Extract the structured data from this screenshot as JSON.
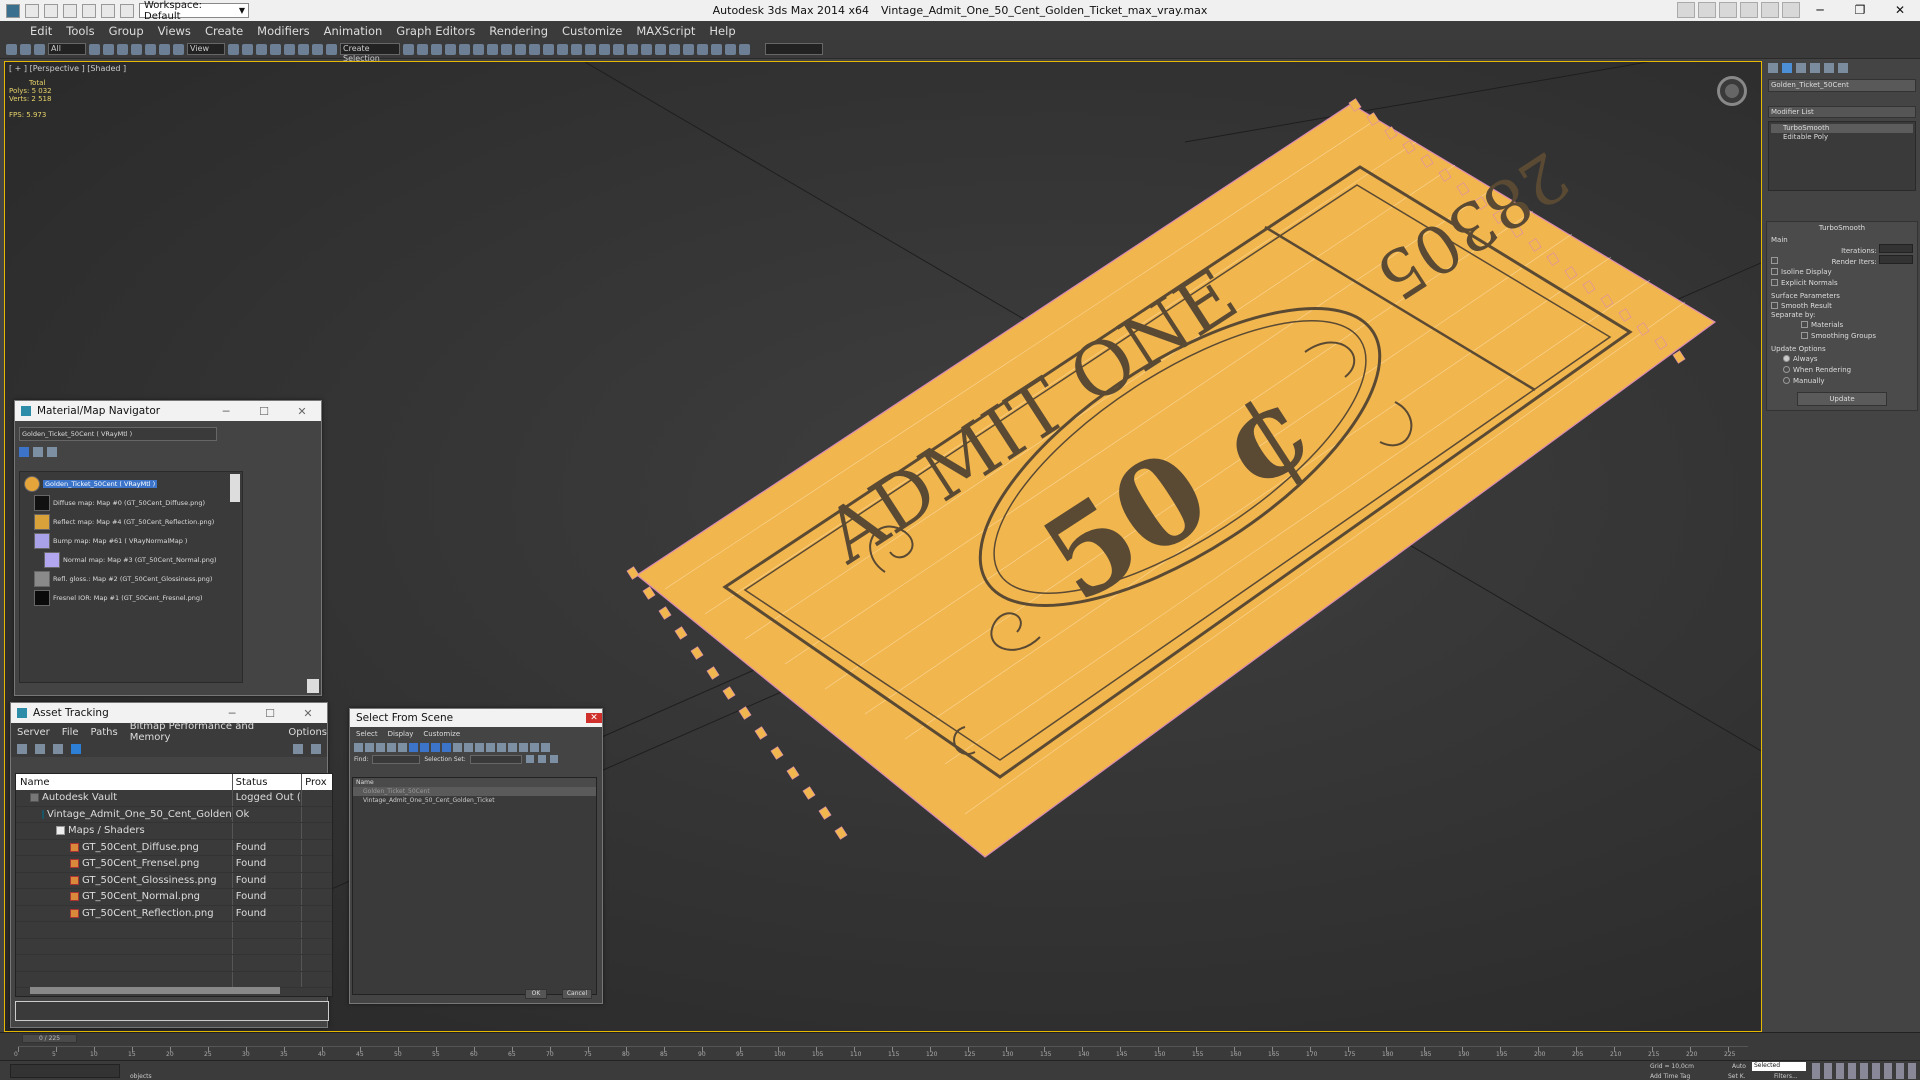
{
  "title_bar": {
    "app": "Autodesk 3ds Max  2014 x64",
    "file": "Vintage_Admit_One_50_Cent_Golden_Ticket_max_vray.max",
    "workspace": "Workspace: Default"
  },
  "menu": [
    "Edit",
    "Tools",
    "Group",
    "Views",
    "Create",
    "Modifiers",
    "Animation",
    "Graph Editors",
    "Rendering",
    "Customize",
    "MAXScript",
    "Help"
  ],
  "toolbar": {
    "selection_filter": "All",
    "ref_coord": "View",
    "named_sel": "Create Selection"
  },
  "viewport": {
    "label": "[ + ] [Perspective ] [Shaded ]",
    "stats": {
      "total": "Total",
      "polys_label": "Polys:",
      "polys": "5 032",
      "verts_label": "Verts:",
      "verts": "2 518",
      "fps_label": "FPS:",
      "fps": "5.973"
    },
    "ticket": {
      "line1": "ADMIT ONE",
      "value": "50 ¢",
      "serial": "28305",
      "color": "#f2b64f",
      "ink": "#5a4a33"
    }
  },
  "command_panel": {
    "object_name": "Golden_Ticket_50Cent",
    "modifier_list": "Modifier List",
    "stack": [
      "TurboSmooth",
      "Editable Poly"
    ],
    "turbosmooth": {
      "title": "TurboSmooth",
      "main": "Main",
      "iterations_label": "Iterations:",
      "render_iters_label": "Render Iters:",
      "isoline": "Isoline Display",
      "explicit": "Explicit Normals",
      "surface": "Surface Parameters",
      "smooth_result": "Smooth Result",
      "separate_by": "Separate by:",
      "materials": "Materials",
      "smoothing_groups": "Smoothing Groups",
      "update_options": "Update Options",
      "always": "Always",
      "when_rendering": "When Rendering",
      "manually": "Manually",
      "update": "Update"
    }
  },
  "material_navigator": {
    "title": "Material/Map Navigator",
    "field": "Golden_Ticket_50Cent  ( VRayMtl )",
    "root": "Golden_Ticket_50Cent  ( VRayMtl )",
    "items": [
      {
        "label": "Diffuse map: Map #0 (GT_50Cent_Diffuse.png)",
        "color": "#111111"
      },
      {
        "label": "Reflect map: Map #4 (GT_50Cent_Reflection.png)",
        "color": "#d9a13a"
      },
      {
        "label": "Bump map: Map #61  ( VRayNormalMap )",
        "color": "#a9a2e8"
      },
      {
        "label": "Normal map: Map #3 (GT_50Cent_Normal.png)",
        "color": "#b3a6f0"
      },
      {
        "label": "Refl. gloss.: Map #2 (GT_50Cent_Glossiness.png)",
        "color": "#8a8a8a"
      },
      {
        "label": "Fresnel IOR: Map #1 (GT_50Cent_Fresnel.png)",
        "color": "#0a0a0a"
      }
    ]
  },
  "asset_tracking": {
    "title": "Asset Tracking",
    "menu": [
      "Server",
      "File",
      "Paths",
      "Bitmap Performance and Memory",
      "Options"
    ],
    "columns": [
      "Name",
      "Status",
      "Prox"
    ],
    "rows": [
      {
        "name": "Autodesk Vault",
        "status": "Logged Out (...",
        "indent": 1
      },
      {
        "name": "Vintage_Admit_One_50_Cent_Golden_...",
        "status": "Ok",
        "indent": 2
      },
      {
        "name": "Maps / Shaders",
        "status": "",
        "indent": 3
      },
      {
        "name": "GT_50Cent_Diffuse.png",
        "status": "Found",
        "indent": 4
      },
      {
        "name": "GT_50Cent_Frensel.png",
        "status": "Found",
        "indent": 4
      },
      {
        "name": "GT_50Cent_Glossiness.png",
        "status": "Found",
        "indent": 4
      },
      {
        "name": "GT_50Cent_Normal.png",
        "status": "Found",
        "indent": 4
      },
      {
        "name": "GT_50Cent_Reflection.png",
        "status": "Found",
        "indent": 4
      }
    ]
  },
  "select_from_scene": {
    "title": "Select From Scene",
    "menu": [
      "Select",
      "Display",
      "Customize"
    ],
    "find_label": "Find:",
    "selection_set": "Selection Set:",
    "column": "Name",
    "items": [
      "Golden_Ticket_50Cent",
      "Vintage_Admit_One_50_Cent_Golden_Ticket"
    ],
    "ok": "OK",
    "cancel": "Cancel"
  },
  "timeline": {
    "frame": "0 / 225",
    "ticks": [
      "0",
      "5",
      "10",
      "15",
      "20",
      "25",
      "30",
      "35",
      "40",
      "45",
      "50",
      "55",
      "60",
      "65",
      "70",
      "75",
      "80",
      "85",
      "90",
      "95",
      "100",
      "105",
      "110",
      "115",
      "120",
      "125",
      "130",
      "135",
      "140",
      "145",
      "150",
      "155",
      "160",
      "165",
      "170",
      "175",
      "180",
      "185",
      "190",
      "195",
      "200",
      "205",
      "210",
      "215",
      "220",
      "225"
    ]
  },
  "status": {
    "objects": "objects",
    "grid": "Grid = 10,0cm",
    "auto": "Auto",
    "selected": "Selected",
    "set_k": "Set K.",
    "filters": "Filters...",
    "add_time_tag": "Add Time Tag"
  }
}
